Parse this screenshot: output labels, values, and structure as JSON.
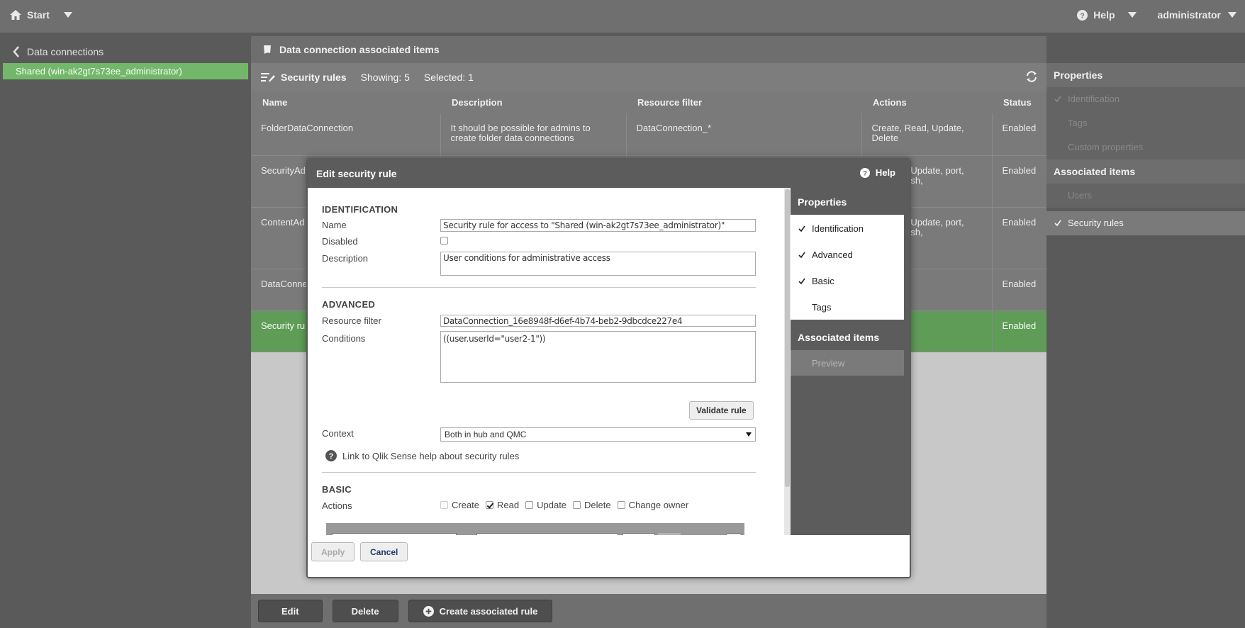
{
  "topbar": {
    "start_label": "Start",
    "help_label": "Help",
    "user_label": "administrator"
  },
  "leftpanel": {
    "back_label": "Data connections",
    "selected_item": "Shared (win-ak2gt7s73ee_administrator)"
  },
  "main": {
    "header_title": "Data connection associated items",
    "toolbar": {
      "title": "Security rules",
      "showing": "Showing: 5",
      "selected": "Selected: 1"
    },
    "columns": [
      "Name",
      "Description",
      "Resource filter",
      "Actions",
      "Status"
    ],
    "rows": [
      {
        "name": "FolderDataConnection",
        "description": "It should be possible for admins to create folder data connections",
        "filter": "DataConnection_*",
        "actions": "Create, Read, Update, Delete",
        "status": "Enabled"
      },
      {
        "name": "SecurityAd",
        "description": "",
        "filter": "",
        "actions": "ead, Update, port, Publish,",
        "status": "Enabled"
      },
      {
        "name": "ContentAd",
        "description": "",
        "filter": "",
        "actions": "ead, Update, port, Publish,",
        "status": "Enabled"
      },
      {
        "name": "DataConne",
        "description": "",
        "filter": "",
        "actions": "",
        "status": "Enabled"
      },
      {
        "name": "Security ru ak2gt7s73",
        "description": "",
        "filter": "",
        "actions": "",
        "status": "Enabled"
      }
    ],
    "bottom": {
      "edit": "Edit",
      "delete": "Delete",
      "create_associated": "Create associated rule"
    }
  },
  "rightpanel": {
    "properties_heading": "Properties",
    "properties_items": [
      "Identification",
      "Tags",
      "Custom properties"
    ],
    "associated_heading": "Associated items",
    "associated_items": [
      "Users",
      "Security rules"
    ]
  },
  "dialog": {
    "title": "Edit security rule",
    "help": "Help",
    "identification": {
      "heading": "IDENTIFICATION",
      "name_label": "Name",
      "name_value": "Security rule for access to \"Shared (win-ak2gt7s73ee_administrator)\"",
      "disabled_label": "Disabled",
      "description_label": "Description",
      "description_value": "User conditions for administrative access"
    },
    "advanced": {
      "heading": "ADVANCED",
      "resource_filter_label": "Resource filter",
      "resource_filter_value": "DataConnection_16e8948f-d6ef-4b74-beb2-9dbcdce227e4",
      "conditions_label": "Conditions",
      "conditions_value": "((user.userId=\"user2-1\"))",
      "validate_label": "Validate rule",
      "context_label": "Context",
      "context_value": "Both in hub and QMC",
      "help_link": "Link to Qlik Sense help about security rules"
    },
    "basic": {
      "heading": "BASIC",
      "actions_label": "Actions",
      "actions": [
        {
          "label": "Create",
          "checked": false
        },
        {
          "label": "Read",
          "checked": true
        },
        {
          "label": "Update",
          "checked": false
        },
        {
          "label": "Delete",
          "checked": false
        },
        {
          "label": "Change owner",
          "checked": false
        }
      ]
    },
    "side": {
      "properties_heading": "Properties",
      "items": [
        "Identification",
        "Advanced",
        "Basic",
        "Tags"
      ],
      "associated_heading": "Associated items",
      "preview": "Preview"
    },
    "apply": "Apply",
    "cancel": "Cancel"
  },
  "colors": {
    "selected_green": "#73b76a",
    "dialog_header": "#5c5c5c"
  }
}
